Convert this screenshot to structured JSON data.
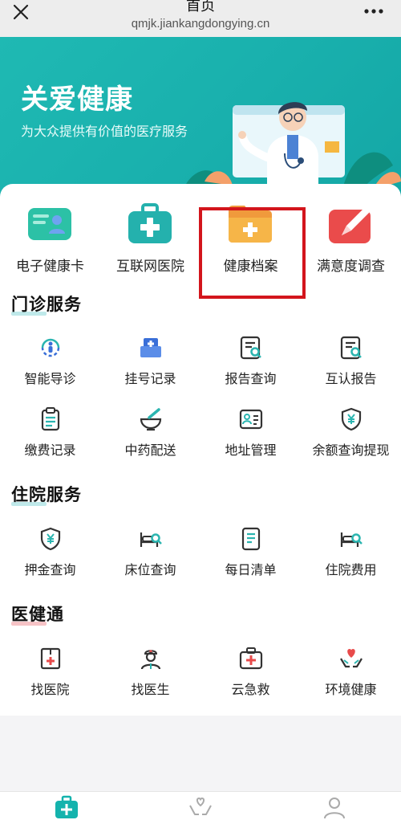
{
  "topbar": {
    "title": "首页",
    "url": "qmjk.jiankangdongying.cn"
  },
  "banner": {
    "title": "关爱健康",
    "subtitle": "为大众提供有价值的医疗服务"
  },
  "quick": [
    {
      "label": "电子健康卡",
      "icon": "health-card-icon"
    },
    {
      "label": "互联网医院",
      "icon": "medical-kit-icon"
    },
    {
      "label": "健康档案",
      "icon": "folder-plus-icon"
    },
    {
      "label": "满意度调查",
      "icon": "pencil-survey-icon"
    }
  ],
  "sections": {
    "outpatient": {
      "title": "门诊服务",
      "items": [
        {
          "label": "智能导诊",
          "icon": "smart-guide-icon"
        },
        {
          "label": "挂号记录",
          "icon": "registration-record-icon"
        },
        {
          "label": "报告查询",
          "icon": "report-query-icon"
        },
        {
          "label": "互认报告",
          "icon": "mutual-report-icon"
        },
        {
          "label": "缴费记录",
          "icon": "payment-record-icon"
        },
        {
          "label": "中药配送",
          "icon": "herbal-mortar-icon"
        },
        {
          "label": "地址管理",
          "icon": "address-card-icon"
        },
        {
          "label": "余额查询提现",
          "icon": "balance-shield-icon"
        }
      ]
    },
    "inpatient": {
      "title": "住院服务",
      "items": [
        {
          "label": "押金查询",
          "icon": "deposit-shield-icon"
        },
        {
          "label": "床位查询",
          "icon": "bed-search-icon"
        },
        {
          "label": "每日清单",
          "icon": "daily-list-icon"
        },
        {
          "label": "住院费用",
          "icon": "hospital-fee-icon"
        }
      ]
    },
    "yijiantong": {
      "title": "医健通",
      "items": [
        {
          "label": "找医院",
          "icon": "hospital-icon"
        },
        {
          "label": "找医生",
          "icon": "doctor-icon"
        },
        {
          "label": "云急救",
          "icon": "first-aid-kit-icon"
        },
        {
          "label": "环境健康",
          "icon": "heart-hands-icon"
        }
      ]
    }
  },
  "bottomnav": [
    {
      "icon": "home-medical-icon",
      "active": true
    },
    {
      "icon": "care-hands-icon",
      "active": false
    },
    {
      "icon": "profile-icon",
      "active": false
    }
  ],
  "colors": {
    "accent": "#14b3ad",
    "highlight": "#d3151c",
    "icon_blue": "#3a6fd8",
    "icon_teal": "#2bb5b0"
  }
}
